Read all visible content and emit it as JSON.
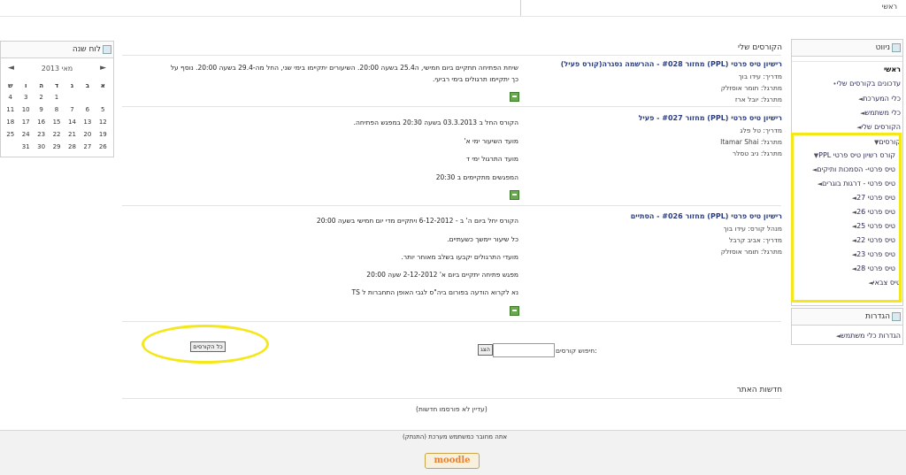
{
  "breadcrumb": "ראשי",
  "calendar": {
    "title": "לוח שנה",
    "month": "מאי 2013",
    "prev": "◄",
    "next": "►",
    "weekdays": [
      "א",
      "ב",
      "ג",
      "ד",
      "ה",
      "ו",
      "ש"
    ],
    "weeks": [
      [
        "",
        "",
        "",
        "1",
        "2",
        "3",
        "4"
      ],
      [
        "5",
        "6",
        "7",
        "8",
        "9",
        "10",
        "11"
      ],
      [
        "12",
        "13",
        "14",
        "15",
        "16",
        "17",
        "18"
      ],
      [
        "19",
        "20",
        "21",
        "22",
        "23",
        "24",
        "25"
      ],
      [
        "26",
        "27",
        "28",
        "29",
        "30",
        "31",
        ""
      ]
    ]
  },
  "navigation": {
    "title": "ניווט",
    "items": [
      {
        "label": "ראשי",
        "bold": true
      },
      {
        "label": "עדכונים בקורסים שלי"
      },
      {
        "label": "כלי המערכת"
      },
      {
        "label": "כלי משתמש"
      },
      {
        "label": "הקורסים שלי"
      },
      {
        "label": "קורסים"
      },
      {
        "label": "קורס רשיון טיס פרטי PPL"
      },
      {
        "label": "טיס פרטי- הסמכות ותיקים"
      },
      {
        "label": "טיס פרטי - דרגות בוגרים"
      },
      {
        "label": "טיס פרטי 27"
      },
      {
        "label": "טיס פרטי 26"
      },
      {
        "label": "טיס פרטי 25"
      },
      {
        "label": "טיס פרטי 22"
      },
      {
        "label": "טיס פרטי 23"
      },
      {
        "label": "טיס פרטי 28"
      },
      {
        "label": "טיס צבאי"
      }
    ]
  },
  "settings": {
    "title": "הגדרות",
    "items": [
      {
        "label": "הגדרות כלי משתמש"
      }
    ]
  },
  "main": {
    "title": "הקורסים שלי",
    "courses": [
      {
        "title": "רישיון טיס פרטי (PPL) מחזור #028 - ההרשמה נסגרה(קורס פעיל)",
        "staff": [
          "מדריך: עידו בוך",
          "מתרגל: תומר אוסזלק",
          "מתרגל: יובל ארז"
        ],
        "summary": [
          "שיחת הפתיחה תתקיים ביום חמישי, ה25.4 בשעה 20:00.  השיעורים יתקיימו בימי שני, החל מה-29.4 בשעה 20:00. נוסף על",
          "כך יתקיימו תרגולים בימי רביעי."
        ]
      },
      {
        "title": "רישיון טיס פרטי (PPL) מחזור #027 - פעיל",
        "staff": [
          "מדריך: טל פלג",
          "מתרגל: Itamar Shai",
          "מתרגל: ניב טסלר"
        ],
        "summary": [
          "הקורס החל ב 03.3.2013 בשעה 20:30 במפגש הפתיחה.",
          "מועד השיעור ימי א'",
          "מועד התרגול ימי ד",
          "המפגשים מתקיימים ב 20:30"
        ]
      },
      {
        "title": "רישיון טיס פרטי (PPL) מחזור #026 - הסתיים",
        "staff": [
          "מנהל קורס: עידו בוך",
          "מדריך: אביב קרבל",
          "מתרגל: תומר אוסזלק"
        ],
        "summary": [
          "הקורס יחל ביום ה' ב - 6-12-2012 ויתקיים  מדי יום חמישי  בשעה 20:00",
          "כל שיעור יימשך כשעתיים.",
          "מועדי התרגולים יקבעו בשלב מאוחר יותר.",
          "מפגש פתיחה יתקיים ביום א' 2-12-2012 שעה 20:00",
          "נא לקרוא הודעה  בפורום ביה\"ס לגבי האופן התחברות ל TS"
        ]
      }
    ],
    "search": {
      "label": "חיפוש קורסים:",
      "button": "הצג",
      "value": ""
    },
    "all_courses_button": "כל הקורסים",
    "news": {
      "title": "חדשות האתר",
      "empty": "(עדיין לא פורסמו חדשות)"
    }
  },
  "footer": {
    "logged_in": "אתה מחובר כמשתמש מערכת (התנתק)",
    "logo": "moodle"
  }
}
